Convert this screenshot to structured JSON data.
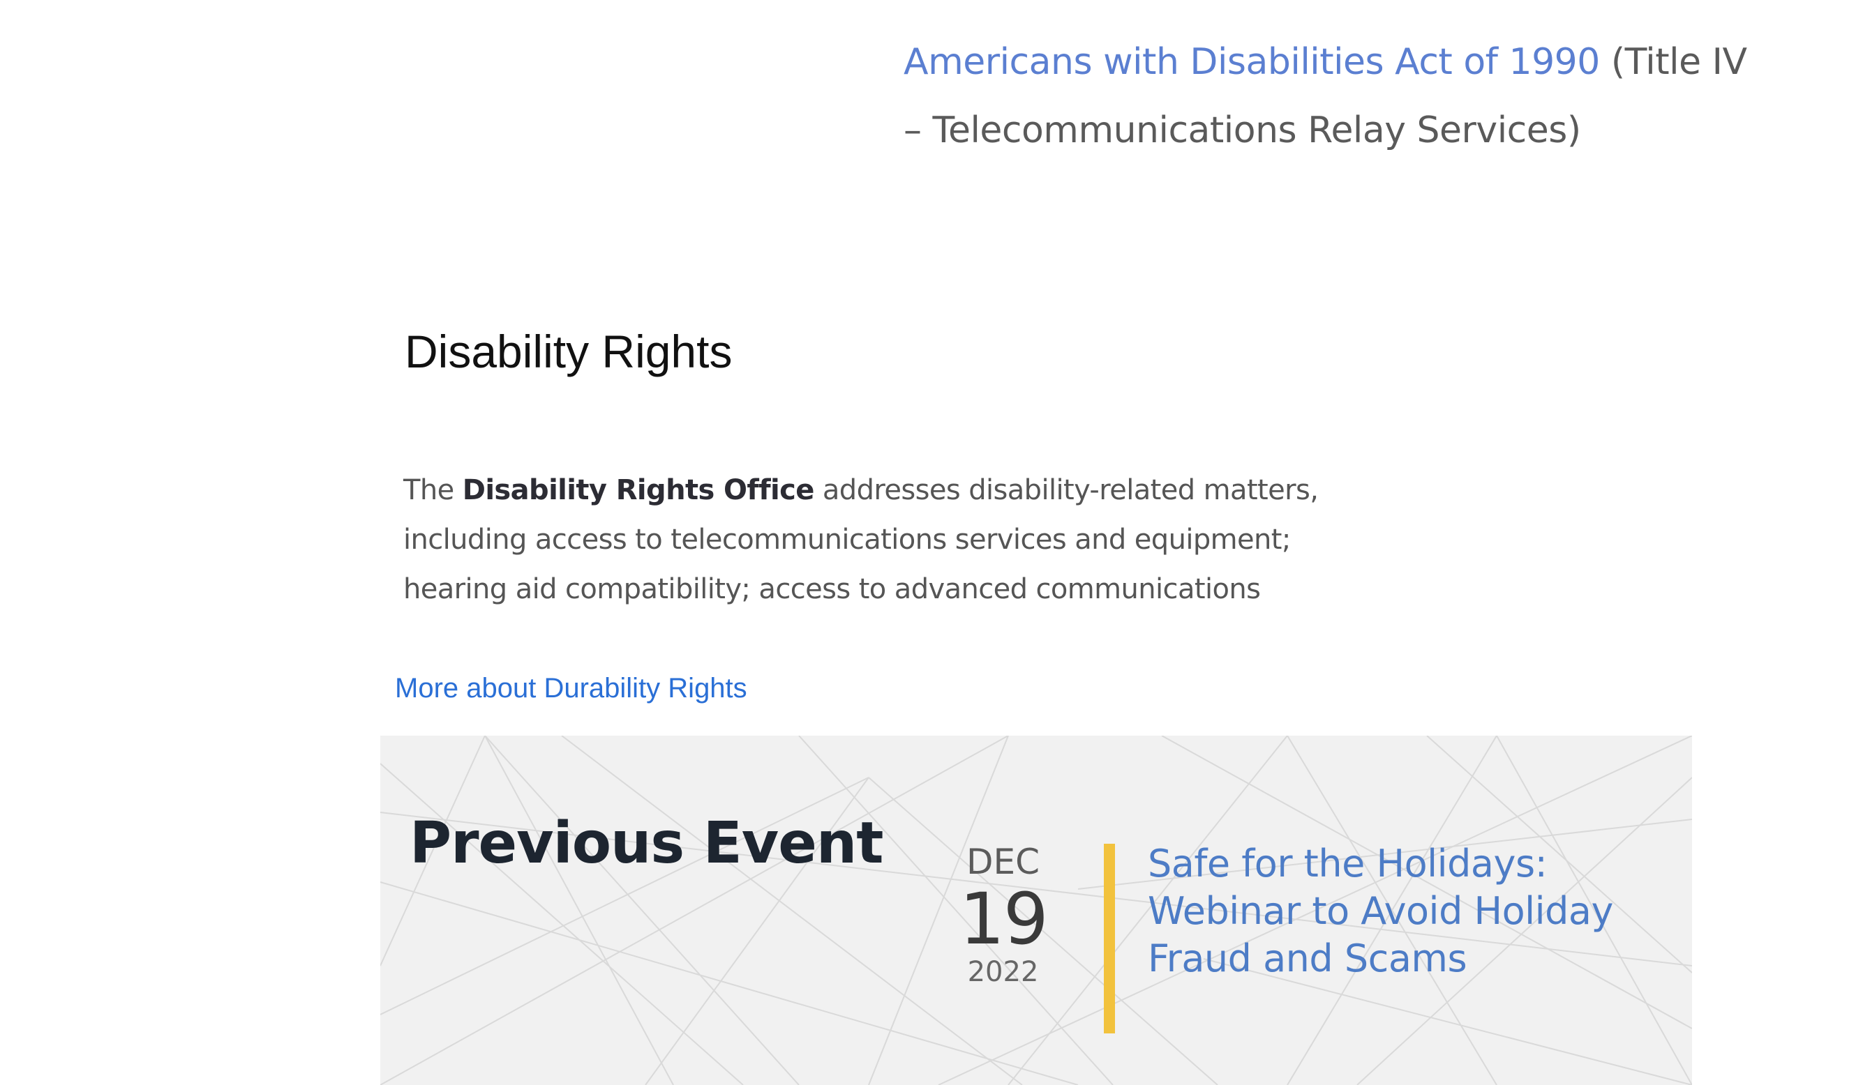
{
  "top_reference": {
    "link_text": "Americans with Disabilities Act of 1990",
    "suffix_text": " (Title IV – Telecommunications Relay Services)"
  },
  "section": {
    "title": "Disability Rights",
    "body_prefix": "The ",
    "body_bold": "Disability Rights Office",
    "body_suffix": " addresses disability-related matters, including access to telecommunications services and equipment; hearing aid compatibility; access to advanced communications",
    "more_link": "More about Durability Rights"
  },
  "previous_event": {
    "heading": "Previous Event",
    "month": "DEC",
    "day": "19",
    "year": "2022",
    "title": "Safe for the Holidays: Webinar to Avoid Holiday Fraud and Scams"
  },
  "colors": {
    "link": "#2a6fd6",
    "accent_bar": "#f2c23d",
    "panel_bg": "#f1f1f1"
  }
}
